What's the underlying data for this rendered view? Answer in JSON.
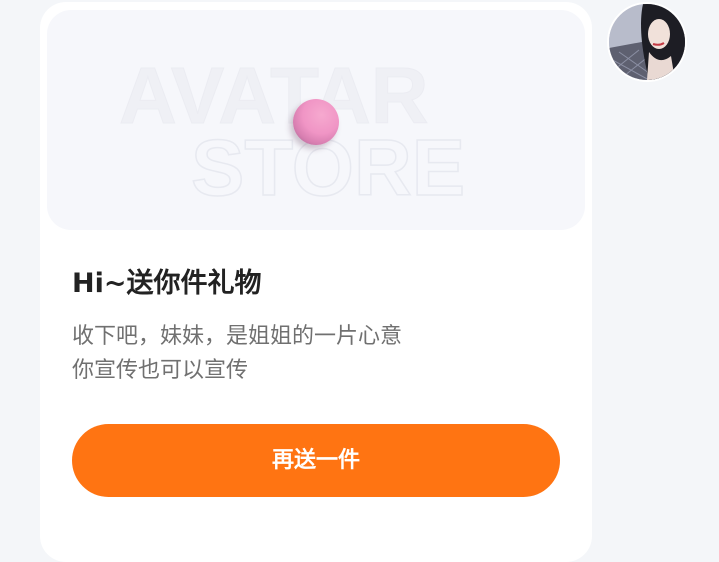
{
  "banner": {
    "watermark_line1": "AVATAR",
    "watermark_line2": "STORE"
  },
  "gift_card": {
    "title": "Hi~送你件礼物",
    "message_line1": "收下吧，妹妹，是姐姐的一片心意",
    "message_line2": "你宣传也可以宣传",
    "button_label": "再送一件"
  },
  "colors": {
    "accent": "#ff7412",
    "gift_dot": "#f095c5",
    "page_background": "#f4f6f9",
    "card_background": "#ffffff"
  },
  "icons": {
    "gift": "gift-preview-icon",
    "avatar": "user-avatar"
  }
}
